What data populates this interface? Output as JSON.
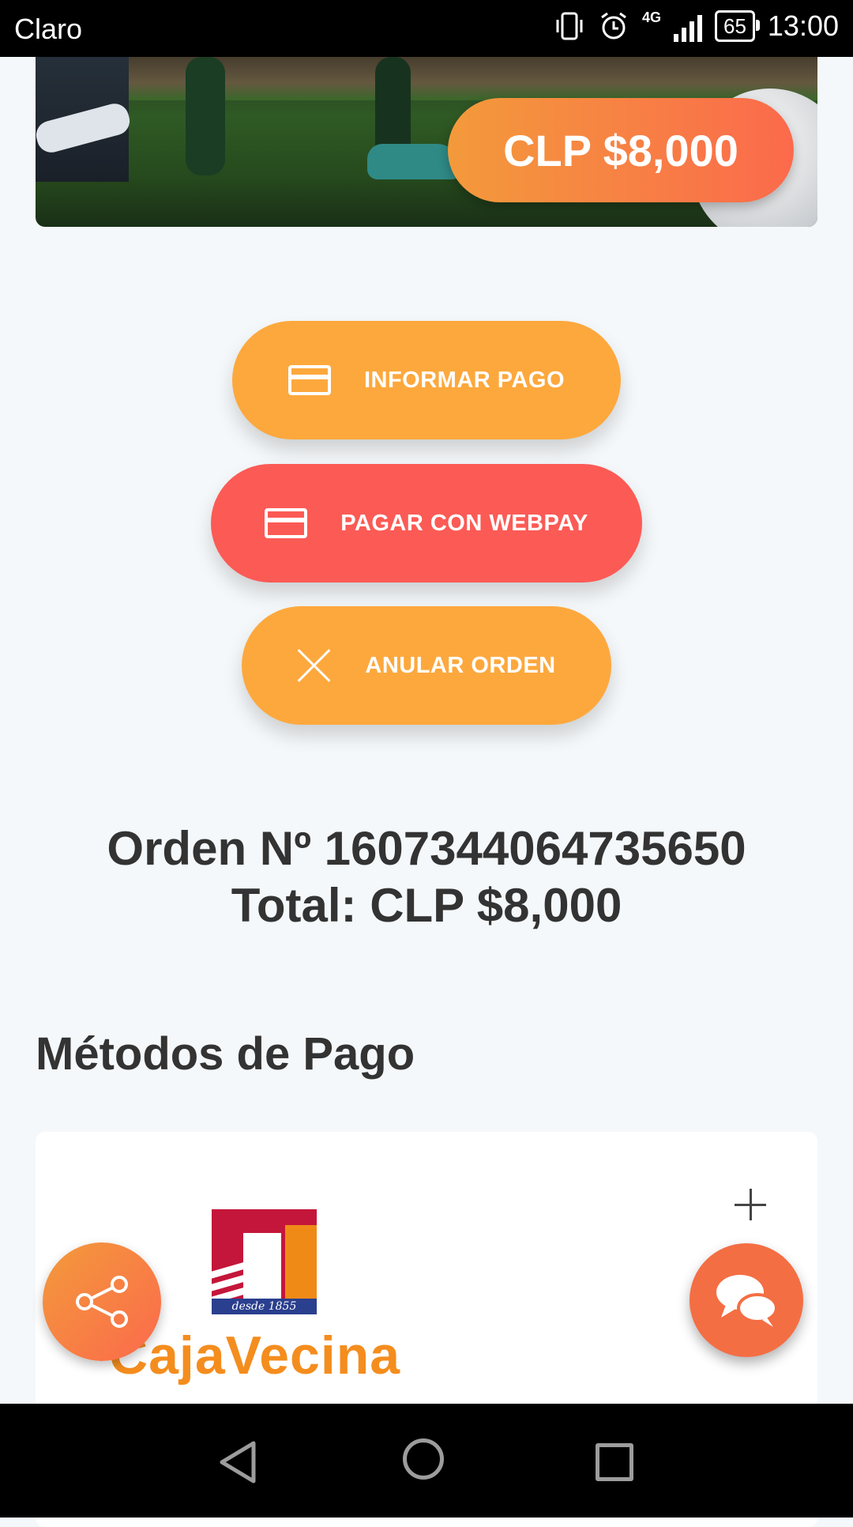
{
  "status_bar": {
    "carrier": "Claro",
    "network": "4G",
    "battery": "65",
    "time": "13:00"
  },
  "hero": {
    "price": "CLP $8,000"
  },
  "actions": {
    "informar_pago": "INFORMAR PAGO",
    "pagar_webpay": "PAGAR CON WEBPAY",
    "anular_orden": "ANULAR ORDEN"
  },
  "order": {
    "number_line": "Orden Nº 1607344064735650",
    "total_line": "Total: CLP $8,000"
  },
  "payment_methods": {
    "title": "Métodos de Pago",
    "items": [
      {
        "name": "CajaVecina",
        "logo_caption": "desde 1855"
      }
    ]
  },
  "colors": {
    "orange": "#fda83d",
    "red": "#fc5a55",
    "text": "#333333",
    "background": "#f5f8fa"
  },
  "icons": [
    "credit-card-icon",
    "close-icon",
    "plus-icon",
    "share-icon",
    "chat-icon",
    "back-icon",
    "home-icon",
    "recents-icon"
  ]
}
